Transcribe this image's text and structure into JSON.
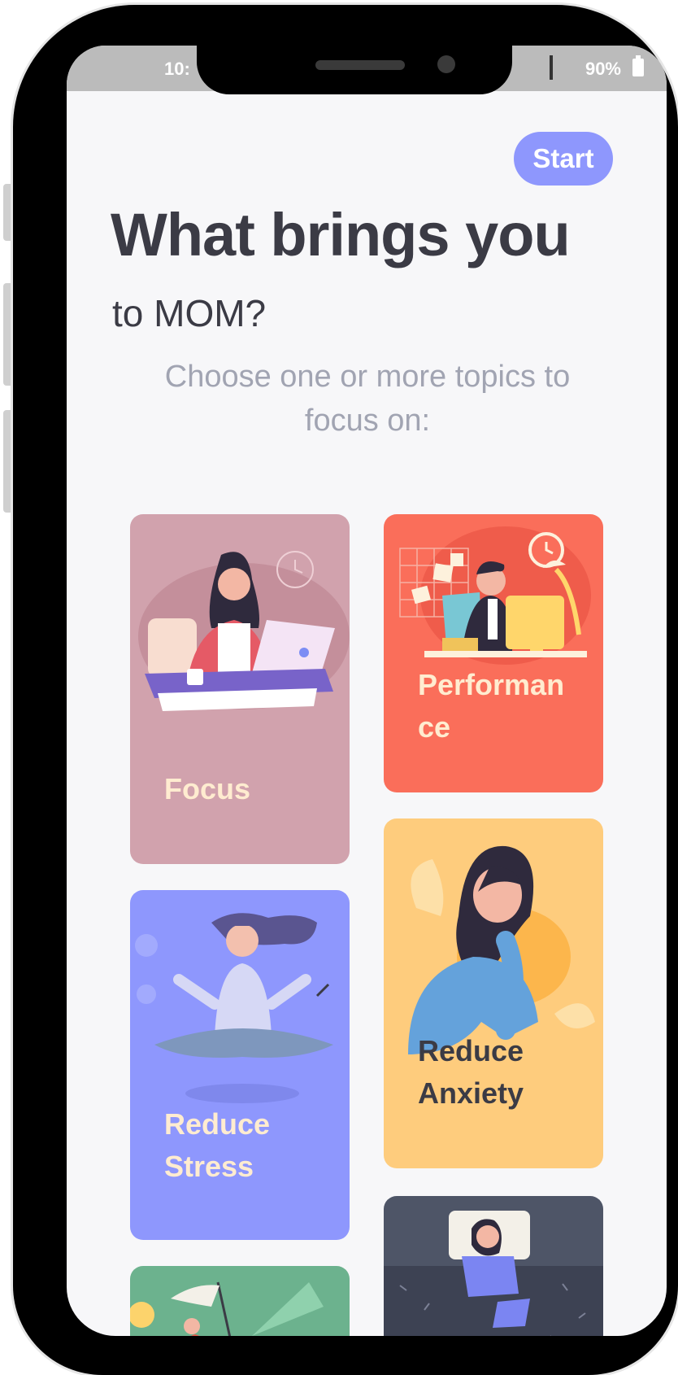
{
  "status_bar": {
    "time": "10:",
    "battery": "90%"
  },
  "header": {
    "start_label": "Start"
  },
  "title": {
    "line1": "What brings you",
    "line2": "to MOM?"
  },
  "subtitle": {
    "line1": "Choose one or more topics to",
    "line2": "focus on:"
  },
  "cards": {
    "focus": {
      "label_line1": "Focus",
      "color": "#d1a2ad"
    },
    "performance": {
      "label_line1": "Performan",
      "label_line2": "ce",
      "color": "#fa6e5a"
    },
    "reduce_stress": {
      "label_line1": "Reduce",
      "label_line2": "Stress",
      "color": "#8e97fd"
    },
    "reduce_anxiety": {
      "label_line1": "Reduce",
      "label_line2": "Anxiety",
      "color": "#fecc7d"
    },
    "sleep": {
      "color": "#4e5567"
    },
    "growth": {
      "color": "#6cb28e"
    }
  },
  "colors": {
    "accent": "#8e97fd",
    "title_text": "#3b3b45",
    "subtitle_text": "#a1a4b2"
  }
}
